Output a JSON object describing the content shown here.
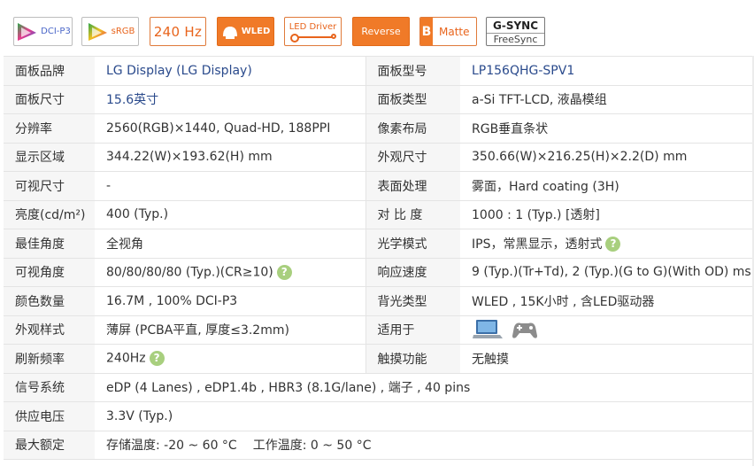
{
  "badges": {
    "dcip3": {
      "label": "DCI-P3",
      "icon": "color-gamut-triangle-icon"
    },
    "srgb": {
      "label": "sRGB",
      "icon": "color-gamut-triangle-icon"
    },
    "refresh": {
      "label": "240 Hz"
    },
    "wled": {
      "label": "WLED",
      "icon": "lamp-icon"
    },
    "led_driver": {
      "label": "LED Driver",
      "icon": "connector-icon"
    },
    "reverse": {
      "label": "Reverse"
    },
    "matte": {
      "letter": "B",
      "label": "Matte"
    },
    "gsync": {
      "line1": "G-SYNC",
      "line2": "FreeSync"
    }
  },
  "colors": {
    "accent": "#f07a28",
    "help": "#a8cf7e",
    "link": "#2a4a8c",
    "label_bg": "#f6f6f6"
  },
  "rows": [
    {
      "l1": "面板品牌",
      "v1": "LG Display (LG Display)",
      "l2": "面板型号",
      "v2": "LP156QHG-SPV1"
    },
    {
      "l1": "面板尺寸",
      "v1": "15.6英寸",
      "l2": "面板类型",
      "v2": "a-Si TFT-LCD, 液晶模组"
    },
    {
      "l1": "分辨率",
      "v1": "2560(RGB)×1440, Quad-HD, 188PPI",
      "l2": "像素布局",
      "v2": "RGB垂直条状"
    },
    {
      "l1": "显示区域",
      "v1": "344.22(W)×193.62(H) mm",
      "l2": "外观尺寸",
      "v2": "350.66(W)×216.25(H)×2.2(D) mm"
    },
    {
      "l1": "可视尺寸",
      "v1": "-",
      "l2": "表面处理",
      "v2": "雾面，Hard coating (3H)"
    },
    {
      "l1": "亮度(cd/m²)",
      "v1": "400 (Typ.)",
      "l2": "对 比 度",
      "v2": "1000 : 1 (Typ.) [透射]"
    },
    {
      "l1": "最佳角度",
      "v1": "全视角",
      "l2": "光学模式",
      "v2": "IPS，常黑显示，透射式"
    },
    {
      "l1": "可视角度",
      "v1": "80/80/80/80 (Typ.)(CR≥10)",
      "l2": "响应速度",
      "v2": "9 (Typ.)(Tr+Td), 2 (Typ.)(G to G)(With OD) ms"
    },
    {
      "l1": "颜色数量",
      "v1": "16.7M , 100% DCI-P3",
      "l2": "背光类型",
      "v2": "WLED , 15K小时 , 含LED驱动器"
    },
    {
      "l1": "外观样式",
      "v1": "薄屏 (PCBA平直, 厚度≤3.2mm)",
      "l2": "适用于",
      "v2": ""
    },
    {
      "l1": "刷新频率",
      "v1": "240Hz",
      "l2": "触摸功能",
      "v2": "无触摸"
    },
    {
      "l1": "信号系统",
      "v1": "eDP (4 Lanes) , eDP1.4b , HBR3 (8.1G/lane) , 端子 , 40 pins"
    },
    {
      "l1": "供应电压",
      "v1": "3.3V (Typ.)"
    },
    {
      "l1": "最大额定",
      "v1a": "存储温度: -20 ~ 60 °C",
      "v1b": "工作温度: 0 ~ 50 °C"
    }
  ],
  "help_mark": "?"
}
